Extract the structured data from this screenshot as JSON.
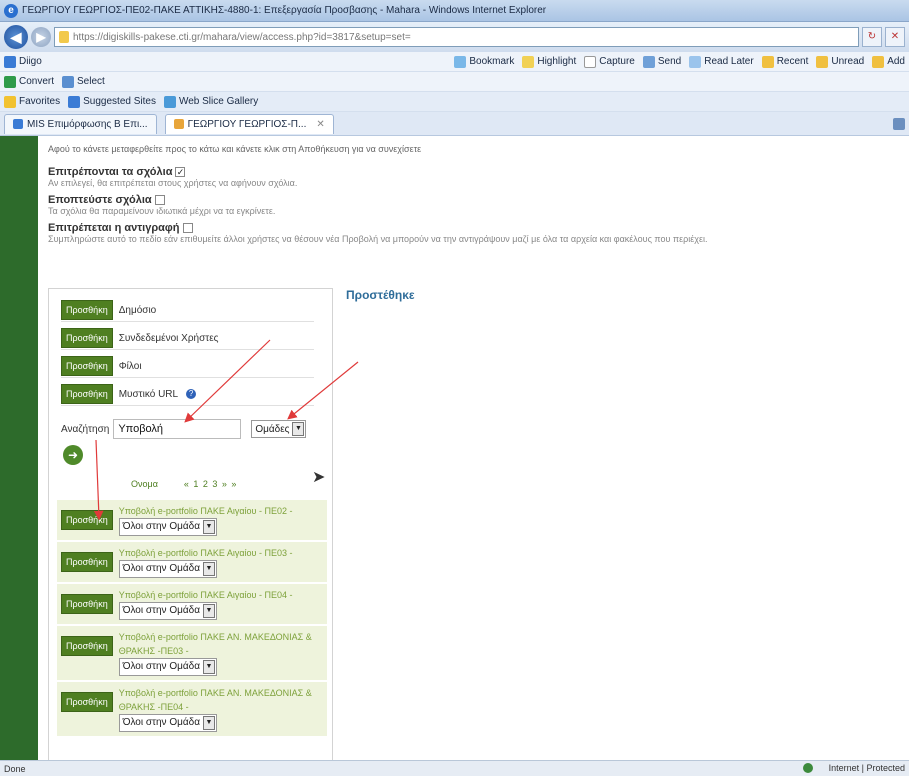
{
  "window": {
    "title": "ΓΕΩΡΓΙΟΥ ΓΕΩΡΓΙΟΣ-ΠΕ02-ΠΑΚΕ ΑΤΤΙΚΗΣ-4880-1: Επεξεργασία Προσβασης - Mahara - Windows Internet Explorer"
  },
  "browser": {
    "address": "https://digiskills-pakese.cti.gr/mahara/view/access.php?id=3817&setup=set=",
    "address_host": "cti.gr",
    "toolbar1": {
      "digo": "Diigo",
      "bookmark": "Bookmark",
      "highlight": "Highlight",
      "capture": "Capture",
      "send": "Send",
      "read_later": "Read Later",
      "recent": "Recent",
      "unread": "Unread",
      "add": "Add"
    },
    "toolbar2": {
      "convert": "Convert",
      "select": "Select"
    },
    "favorites": {
      "label": "Favorites",
      "suggested": "Suggested Sites",
      "webslice": "Web Slice Gallery"
    },
    "tabs": [
      {
        "label": "MIS Επιμόρφωσης Β Επι..."
      },
      {
        "label": "ΓΕΩΡΓΙΟΥ ΓΕΩΡΓΙΟΣ-Π..."
      }
    ]
  },
  "page": {
    "intro": "Αφού το κάνετε μεταφερθείτε προς το κάτω και κάνετε κλικ στη Αποθήκευση για να συνεχίσετε",
    "options": [
      {
        "label": "Επιτρέπονται τα σχόλια",
        "checked": true,
        "desc": "Αν επιλεγεί, θα επιτρέπεται στους χρήστες να αφήνουν σχόλια."
      },
      {
        "label": "Εποπτεύστε σχόλια",
        "checked": false,
        "desc": "Τα σχόλια θα παραμείνουν ιδιωτικά μέχρι να τα εγκρίνετε."
      },
      {
        "label": "Επιτρέπεται η αντιγραφή",
        "checked": false,
        "desc": "Συμπληρώστε αυτό το πεδίο εάν επιθυμείτε άλλοι χρήστες να θέσουν νέα Προβολή να μπορούν να την αντιγράψουν μαζί με όλα τα αρχεία και φακέλους που περιέχει."
      }
    ],
    "add_button": "Προσθήκη",
    "add_items": [
      "Δημόσιο",
      "Συνδεδεμένοι Χρήστες",
      "Φίλοι",
      "Μυστικό URL"
    ],
    "search": {
      "label": "Αναζήτηση",
      "value": "Υποβολή",
      "type": "Ομάδες"
    },
    "pager": {
      "label": "Ονομα",
      "pages": "« 1 2 3  » »"
    },
    "results": [
      {
        "name": "Υποβολή e-portfolio ΠΑΚΕ Αιγαίου - ΠΕ02 -",
        "role": "Όλοι στην Ομάδα"
      },
      {
        "name": "Υποβολή e-portfolio ΠΑΚΕ Αιγαίου - ΠΕ03 -",
        "role": "Όλοι στην Ομάδα"
      },
      {
        "name": "Υποβολή e-portfolio ΠΑΚΕ Αιγαίου - ΠΕ04 -",
        "role": "Όλοι στην Ομάδα"
      },
      {
        "name": "Υποβολή e-portfolio ΠΑΚΕ ΑΝ. ΜΑΚΕΔΟΝΙΑΣ & ΘΡΑΚΗΣ -ΠΕ03 -",
        "role": "Όλοι στην Ομάδα"
      },
      {
        "name": "Υποβολή e-portfolio ΠΑΚΕ ΑΝ. ΜΑΚΕΔΟΝΙΑΣ & ΘΡΑΚΗΣ -ΠΕ04 -",
        "role": "Όλοι στην Ομάδα"
      }
    ],
    "added_heading": "Προστέθηκε"
  },
  "status": {
    "left": "Done",
    "zone": "Internet | Protected"
  },
  "colors": {
    "accent": "#4f7f21",
    "sidebar": "#2d6b2b",
    "annotation": "#e03a3a"
  }
}
